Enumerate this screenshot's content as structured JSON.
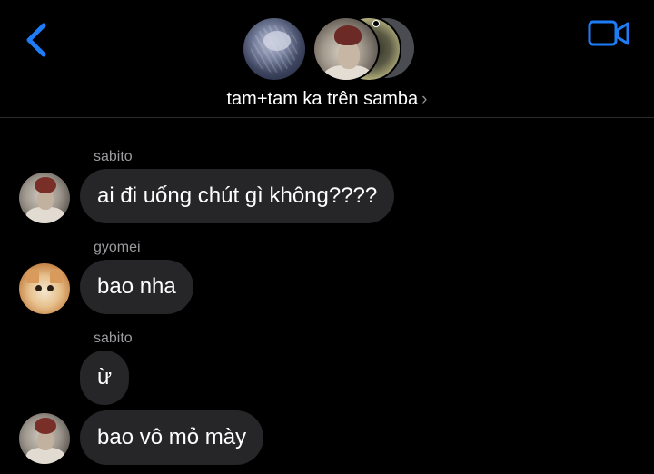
{
  "header": {
    "back_icon": "chevron-left-icon",
    "video_icon": "video-camera-icon",
    "accent_color": "#1e7cf6",
    "group_name": "tam+tam ka trên samba",
    "chevron": "›"
  },
  "messages": [
    {
      "sender": "sabito",
      "text": "ai đi uống chút gì không????"
    },
    {
      "sender": "gyomei",
      "text": "bao nha"
    },
    {
      "sender": "sabito",
      "text": "ừ"
    },
    {
      "text": "bao vô mỏ mày"
    }
  ]
}
